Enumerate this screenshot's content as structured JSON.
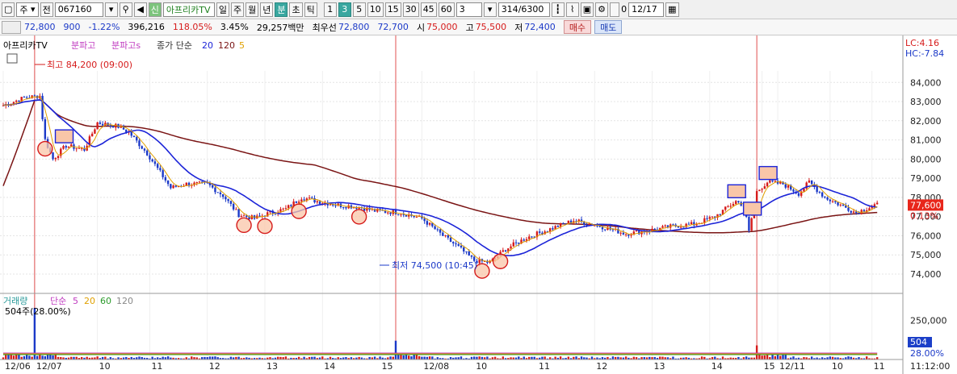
{
  "toolbar": {
    "market": "주",
    "prev_label": "전",
    "code": "067160",
    "name": "아프리카TV",
    "name_badge": "신",
    "period_buttons": [
      "일",
      "주",
      "월",
      "년",
      "분",
      "초",
      "틱"
    ],
    "active_period": "분",
    "interval_buttons": [
      "1",
      "3",
      "5",
      "10",
      "15",
      "30",
      "45",
      "60"
    ],
    "active_interval": "3",
    "interval_value": "3",
    "count": "314",
    "count_total": "/6300",
    "zero_label": "0",
    "date": "12/17"
  },
  "info": {
    "price": "72,800",
    "change": "900",
    "change_pct": "-1.22%",
    "volume": "396,216",
    "volume_ratio": "118.05%",
    "turnover": "3.45%",
    "amount": "29,257백만",
    "best_ask_label": "최우선",
    "best_ask": "72,800",
    "best_bid": "72,700",
    "open_label": "시",
    "open": "75,000",
    "high_label": "고",
    "high": "75,500",
    "low_label": "저",
    "low": "72,400",
    "buy_label": "매수",
    "sell_label": "매도"
  },
  "legend": {
    "name": "아프리카TV",
    "ind1": "분파고",
    "ind2": "분파고s",
    "ma_label": "종가 단순",
    "ma_periods": [
      "20",
      "120",
      "5"
    ],
    "lc": "LC:4.16",
    "hc": "HC:-7.84",
    "high_note": "최고 84,200 (09:00)",
    "low_note": "최저 74,500 (10:45)",
    "vol_label": "거래량",
    "vol_ma_label": "단순",
    "vol_ma_periods": [
      "5",
      "20",
      "60",
      "120"
    ],
    "vol_current": "504주(28.00%)"
  },
  "colors": {
    "up": "#d61b1b",
    "down": "#1b39c8",
    "ma20": "#1c24d8",
    "ma120": "#7a1414",
    "ma5": "#e0a000",
    "volma5": "#c03cc0",
    "volma20": "#e0a000",
    "volma60": "#2a9a2a",
    "volma120": "#888888",
    "vline": "#e05050"
  },
  "chart_data": {
    "type": "candlestick",
    "price_ylim": [
      73200,
      84600
    ],
    "price_ticks": [
      "84,000",
      "83,000",
      "82,000",
      "81,000",
      "80,000",
      "79,000",
      "78,000",
      "77,000",
      "76,000",
      "75,000",
      "74,000"
    ],
    "current_price_label": "77,600",
    "current_pct_label": "0.13%",
    "volume_ylim": [
      0,
      340000
    ],
    "volume_tick": "250,000",
    "volume_current_label": "504",
    "volume_pct_label": "28.00%",
    "time_labels": [
      "12/06",
      "12/07",
      "10",
      "11",
      "12",
      "13",
      "14",
      "15",
      "12/08",
      "10",
      "11",
      "12",
      "13",
      "14",
      "15",
      "12/11",
      "10",
      "11",
      "11:12:00"
    ],
    "session_dividers": [
      "12/07",
      "12/08",
      "12/11"
    ],
    "close_anchors": [
      [
        0,
        82800
      ],
      [
        8,
        83200
      ],
      [
        14,
        83300
      ],
      [
        16,
        81000
      ],
      [
        19,
        80000
      ],
      [
        24,
        80700
      ],
      [
        31,
        80500
      ],
      [
        36,
        81900
      ],
      [
        44,
        81700
      ],
      [
        48,
        81400
      ],
      [
        55,
        80300
      ],
      [
        64,
        78500
      ],
      [
        70,
        78700
      ],
      [
        78,
        78700
      ],
      [
        84,
        78100
      ],
      [
        90,
        77100
      ],
      [
        96,
        76900
      ],
      [
        102,
        77200
      ],
      [
        108,
        77400
      ],
      [
        114,
        78000
      ],
      [
        120,
        77800
      ],
      [
        128,
        77600
      ],
      [
        136,
        77500
      ],
      [
        142,
        77300
      ],
      [
        152,
        77200
      ],
      [
        160,
        76900
      ],
      [
        168,
        76000
      ],
      [
        174,
        75400
      ],
      [
        180,
        74700
      ],
      [
        186,
        74600
      ],
      [
        192,
        75300
      ],
      [
        200,
        75900
      ],
      [
        210,
        76400
      ],
      [
        218,
        76800
      ],
      [
        228,
        76500
      ],
      [
        238,
        76100
      ],
      [
        248,
        76300
      ],
      [
        256,
        76500
      ],
      [
        264,
        76600
      ],
      [
        272,
        77000
      ],
      [
        280,
        77800
      ],
      [
        283,
        77600
      ],
      [
        285,
        76200
      ],
      [
        288,
        78300
      ],
      [
        292,
        78800
      ],
      [
        298,
        78700
      ],
      [
        304,
        78200
      ],
      [
        308,
        78800
      ],
      [
        314,
        78000
      ],
      [
        320,
        77600
      ],
      [
        326,
        77200
      ],
      [
        333,
        77600
      ]
    ],
    "highlight_boxes": [
      23,
      280,
      286,
      292
    ],
    "highlight_circles": [
      16,
      92,
      100,
      113,
      136,
      183,
      190
    ]
  }
}
